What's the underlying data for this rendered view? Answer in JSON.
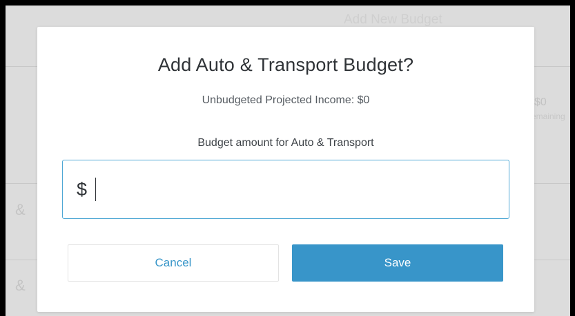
{
  "background": {
    "heading": "Add New Budget",
    "amount": "$0",
    "amount_caption": "remaining",
    "row_glyph_1": "&",
    "row_glyph_2": "&"
  },
  "dialog": {
    "title": "Add Auto & Transport Budget?",
    "subtitle": "Unbudgeted Projected Income: $0",
    "field_label": "Budget amount for Auto & Transport",
    "currency_symbol": "$",
    "input_value": "",
    "cancel_label": "Cancel",
    "save_label": "Save"
  },
  "colors": {
    "accent": "#3895c9",
    "input_border": "#4fa8d5",
    "frame": "#000000"
  }
}
